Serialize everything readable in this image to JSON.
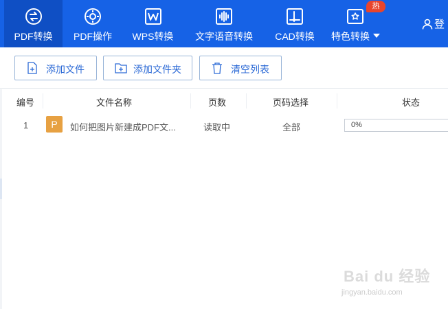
{
  "nav": {
    "items": [
      {
        "label": "PDF转换",
        "icon": "pdf-convert-icon"
      },
      {
        "label": "PDF操作",
        "icon": "pdf-operate-icon"
      },
      {
        "label": "WPS转换",
        "icon": "wps-icon"
      },
      {
        "label": "文字语音转换",
        "icon": "audio-wave-icon"
      },
      {
        "label": "CAD转换",
        "icon": "cad-icon"
      },
      {
        "label": "特色转换",
        "icon": "feature-convert-icon"
      }
    ],
    "hot_badge": "热",
    "login": "登"
  },
  "toolbar": {
    "add_file": "添加文件",
    "add_folder": "添加文件夹",
    "clear_list": "清空列表"
  },
  "table": {
    "headers": [
      "编号",
      "文件名称",
      "页数",
      "页码选择",
      "状态"
    ],
    "rows": [
      {
        "index": "1",
        "file_type": "P",
        "file_name": "如何把图片新建成PDF文...",
        "pages": "读取中",
        "page_range": "全部",
        "progress_text": "0%",
        "progress": 0
      }
    ]
  },
  "watermark": {
    "brand": "Bai du 经验",
    "url": "jingyan.baidu.com"
  },
  "colors": {
    "nav_bg": "#1662e6",
    "nav_active": "#0f4fc4",
    "accent": "#2c6ad6",
    "hot": "#e8452c",
    "file_icon": "#e7a142"
  }
}
